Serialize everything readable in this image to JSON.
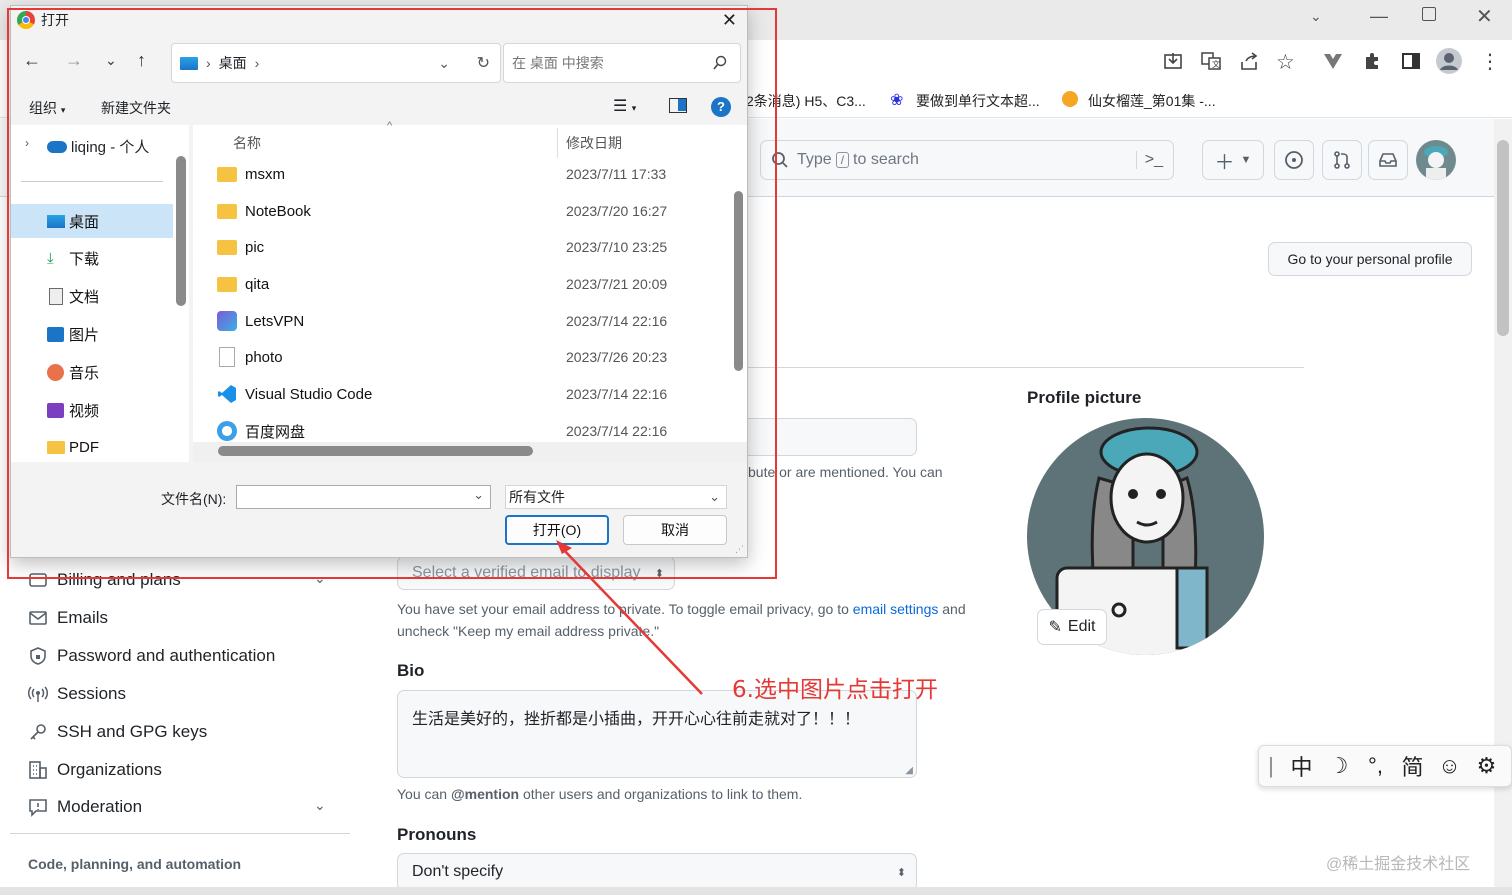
{
  "browser": {
    "bookmarks": [
      "2条消息) H5、C3...",
      "要做到单行文本超...",
      "仙女榴莲_第01集 -..."
    ]
  },
  "github": {
    "search_placeholder_prefix": "Type",
    "search_key": "/",
    "search_placeholder_suffix": "to search",
    "profile_button": "Go to your personal profile",
    "profile_picture_label": "Profile picture",
    "edit_label": "Edit",
    "email_note_partial": "bute or are mentioned. You can",
    "email_select_placeholder": "Select a verified email to display",
    "email_privacy_note_1": "You have set your email address to private. To toggle email privacy, go to",
    "email_settings_link": "email settings",
    "email_privacy_note_2": "and",
    "email_privacy_note_3": "uncheck \"Keep my email address private.\"",
    "bio_label": "Bio",
    "bio_value": "生活是美好的，挫折都是小插曲，开开心心往前走就对了！！！",
    "mention_prefix": "You can",
    "mention_bold": "@mention",
    "mention_suffix": "other users and organizations to link to them.",
    "pronouns_label": "Pronouns",
    "pronouns_value": "Don't specify",
    "sidebar": [
      {
        "label": "Billing and plans",
        "icon": "credit-card-icon"
      },
      {
        "label": "Emails",
        "icon": "mail-icon"
      },
      {
        "label": "Password and authentication",
        "icon": "shield-lock-icon"
      },
      {
        "label": "Sessions",
        "icon": "broadcast-icon"
      },
      {
        "label": "SSH and GPG keys",
        "icon": "key-icon"
      },
      {
        "label": "Organizations",
        "icon": "organization-icon"
      },
      {
        "label": "Moderation",
        "icon": "report-icon"
      }
    ],
    "sidebar_section": "Code, planning, and automation"
  },
  "dialog": {
    "title": "打开",
    "breadcrumb": "桌面",
    "search_placeholder": "在 桌面 中搜索",
    "organize": "组织",
    "new_folder": "新建文件夹",
    "nav_root": "liqing - 个人",
    "nav_items": [
      {
        "label": "桌面",
        "icon": "desktop-icon"
      },
      {
        "label": "下载",
        "icon": "download-icon"
      },
      {
        "label": "文档",
        "icon": "document-icon"
      },
      {
        "label": "图片",
        "icon": "pictures-icon"
      },
      {
        "label": "音乐",
        "icon": "music-icon"
      },
      {
        "label": "视频",
        "icon": "video-icon"
      },
      {
        "label": "PDF",
        "icon": "folder-icon"
      }
    ],
    "col_name": "名称",
    "col_date": "修改日期",
    "files": [
      {
        "name": "msxm",
        "date": "2023/7/11 17:33",
        "icon": "folder-icon"
      },
      {
        "name": "NoteBook",
        "date": "2023/7/20 16:27",
        "icon": "folder-icon"
      },
      {
        "name": "pic",
        "date": "2023/7/10 23:25",
        "icon": "folder-icon"
      },
      {
        "name": "qita",
        "date": "2023/7/21 20:09",
        "icon": "folder-icon"
      },
      {
        "name": "LetsVPN",
        "date": "2023/7/14 22:16",
        "icon": "app-shortcut-icon"
      },
      {
        "name": "photo",
        "date": "2023/7/26 20:23",
        "icon": "image-file-icon"
      },
      {
        "name": "Visual Studio Code",
        "date": "2023/7/14 22:16",
        "icon": "vscode-icon"
      },
      {
        "name": "百度网盘",
        "date": "2023/7/14 22:16",
        "icon": "cloud-app-icon"
      }
    ],
    "filename_label": "文件名(N):",
    "filename_value": "",
    "filetype": "所有文件",
    "open_button": "打开(O)",
    "cancel_button": "取消"
  },
  "annotation": "6.选中图片点击打开",
  "ime": [
    "中",
    "☽",
    "°,",
    "简",
    "☺",
    "⚙"
  ],
  "watermark": "@稀土掘金技术社区",
  "colors": {
    "accent_red": "#e53935",
    "link": "#0969da",
    "folder": "#f5c242"
  }
}
